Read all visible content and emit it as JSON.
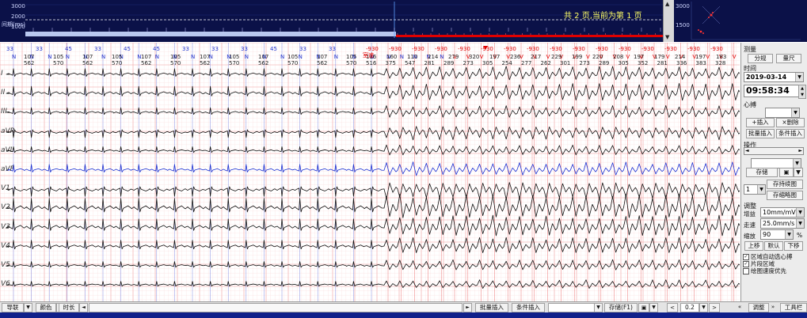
{
  "trend": {
    "y_axis_label": "间期(ms)",
    "y_ticks": [
      "3000",
      "2000",
      "1000"
    ],
    "page_info": "共 2 页,当前为第 1 页"
  },
  "minimap": {
    "labels": [
      "3000",
      "1500"
    ]
  },
  "rr_markers": {
    "top_values": [
      "33",
      "33",
      "45",
      "33",
      "45",
      "45",
      "33",
      "33",
      "33",
      "45",
      "33",
      "33",
      "-930",
      "-930",
      "-930",
      "-930",
      "-930",
      "-930",
      "-930",
      "-930",
      "-930",
      "-930",
      "-930",
      "-930",
      "-930",
      "-930",
      "-930",
      "-930"
    ],
    "beat_types": [
      "N",
      "N",
      "N",
      "N",
      "N",
      "N",
      "N",
      "N",
      "N",
      "N",
      "N",
      "N",
      "N",
      "N",
      "N",
      "N",
      "N",
      "N",
      "N",
      "N",
      "N",
      "N",
      "N",
      "N",
      "N",
      "N",
      "V",
      "V",
      "V",
      "V",
      "V",
      "V",
      "V",
      "V",
      "V",
      "V",
      "V",
      "V",
      "V",
      "V"
    ],
    "pacing_label": "室速",
    "rr_top": [
      "107",
      "105",
      "107",
      "105",
      "107",
      "105",
      "107",
      "105",
      "107",
      "105",
      "107",
      "105",
      "116",
      "160",
      "110",
      "214",
      "279",
      "320",
      "197",
      "236",
      "217",
      "229",
      "199",
      "220",
      "208",
      "197",
      "179",
      "214",
      "197",
      "183"
    ],
    "rr_bottom": [
      "562",
      "570",
      "562",
      "570",
      "562",
      "570",
      "562",
      "570",
      "562",
      "570",
      "562",
      "570",
      "516",
      "375",
      "547",
      "281",
      "289",
      "273",
      "305",
      "254",
      "277",
      "262",
      "301",
      "273",
      "289",
      "305",
      "352",
      "281",
      "336",
      "383",
      "328"
    ]
  },
  "leads": [
    "I",
    "II",
    "III",
    "aVR",
    "aVL",
    "aVF",
    "V1",
    "V2",
    "V3",
    "V4",
    "V5",
    "V6"
  ],
  "right_panel": {
    "measure_title": "测量",
    "btn_caliper": "分规",
    "btn_ruler": "量尺",
    "time_title": "时间",
    "date_value": "2019-03-14",
    "time_value": "09:58:34",
    "beat_title": "心搏",
    "beat_select": "",
    "btn_insert": "+插入",
    "btn_delete": "×删除",
    "btn_batch_insert": "批量插入",
    "btn_cond_insert": "条件插入",
    "operate_title": "操作",
    "btn_save": "存储",
    "btn_save_strip": "存持续图",
    "strip_count": "1",
    "btn_save_thumb": "存缩略图",
    "adjust_title": "调整",
    "gain_label": "增益",
    "gain_value": "10mm/mV",
    "speed_label": "走速",
    "speed_value": "25.0mm/s",
    "scale_label": "缩放",
    "scale_value": "90",
    "scale_unit": "%",
    "btn_up": "上移",
    "btn_default": "默认",
    "btn_down": "下移",
    "chk_auto_beat": "区域自动选心搏",
    "chk_segment": "片段区域",
    "chk_speed_priority": "绘图速度优先"
  },
  "bottom_bar": {
    "nav": "导联",
    "color": "颜色",
    "duration": "时长",
    "batch_insert": "批量插入",
    "cond_insert": "条件插入",
    "save_f1": "存储(F1)",
    "zoom": "0.2",
    "adjust": "调整",
    "toolbox": "工具栏"
  },
  "colors": {
    "trend_bg": "#0b1148",
    "trend_accent": "#ffff66",
    "marker_red": "#e00000",
    "marker_blue": "#2233cc",
    "grid_major": "#f2a6a6",
    "grid_minor": "#fbe3e3",
    "highlight_lead": "#1a2fd0",
    "status_bar": "#10208a"
  }
}
